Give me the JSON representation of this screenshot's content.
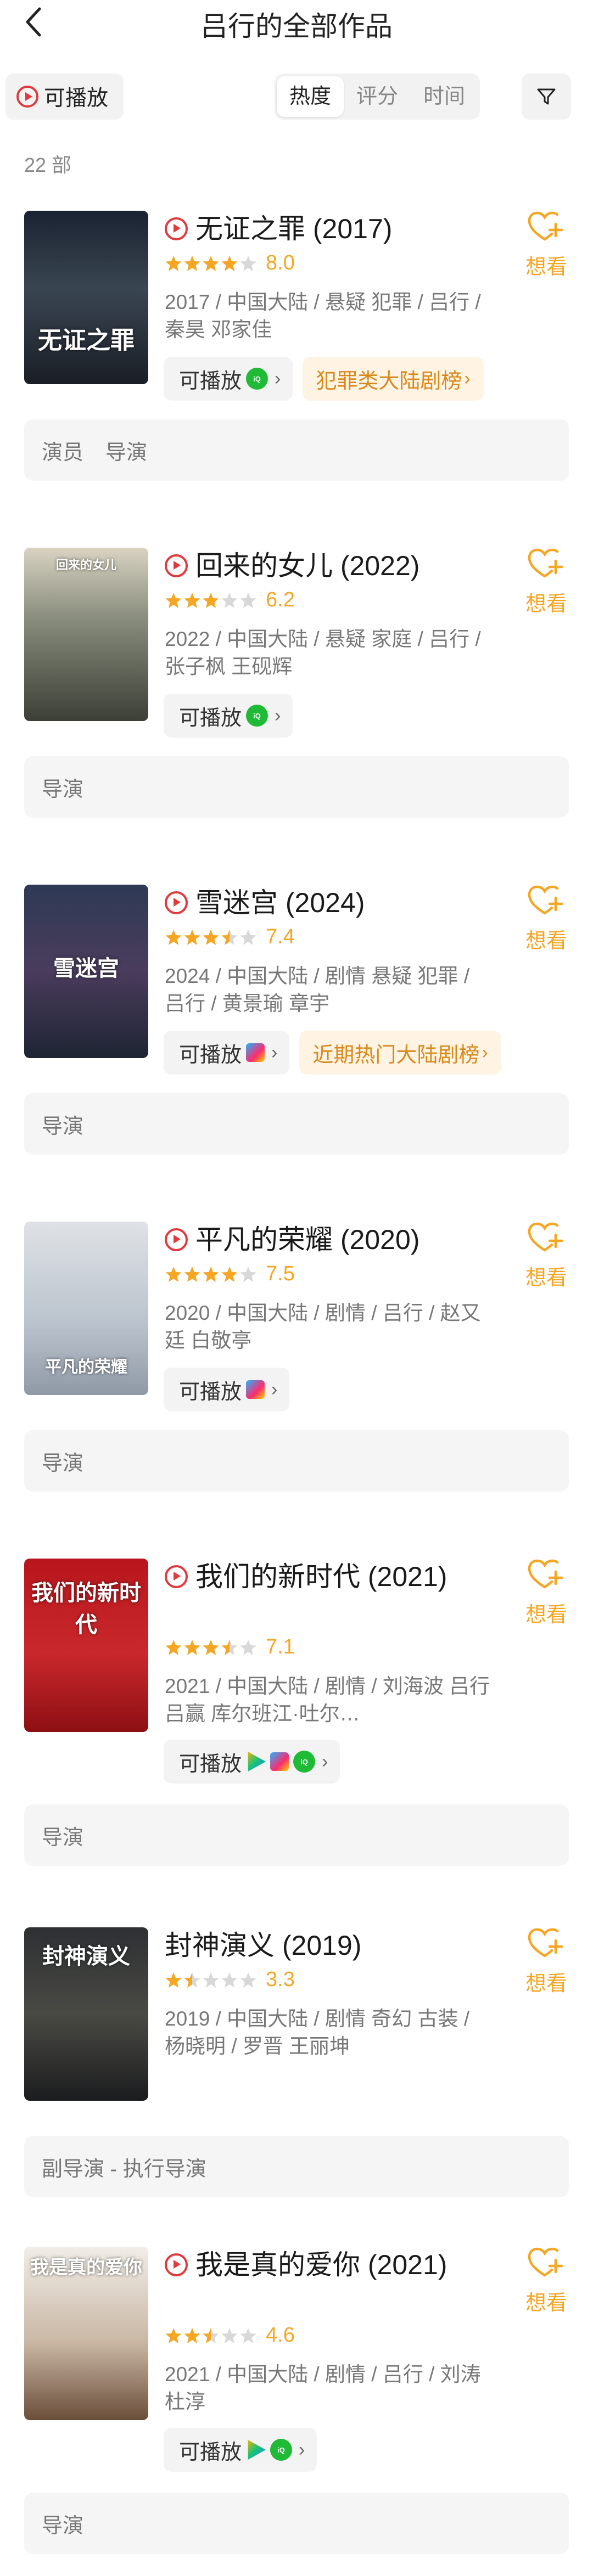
{
  "header": {
    "title": "吕行的全部作品",
    "back_icon": "back-icon"
  },
  "filters": {
    "playable_label": "可播放",
    "sort_tabs": [
      "热度",
      "评分",
      "时间"
    ],
    "active_sort": "热度",
    "filter_icon": "funnel-icon"
  },
  "count_label": "22 部",
  "colors": {
    "accent": "#f5a623",
    "play_red": "#e0393e",
    "rank_text": "#d8891d",
    "rank_bg": "#fff4e3"
  },
  "items": [
    {
      "name": "无证之罪 (2017)",
      "has_play_icon": true,
      "stars": 4,
      "rating": "8.0",
      "meta": "2017 / 中国大陆 / 悬疑 犯罪 / 吕行 / 秦昊 邓家佳",
      "play_label": "可播放",
      "platforms": [
        "iqiyi"
      ],
      "rank": "犯罪类大陆剧榜",
      "want_label": "想看",
      "roles": [
        "演员",
        "导演"
      ],
      "poster_text": "无证之罪"
    },
    {
      "name": "回来的女儿 (2022)",
      "has_play_icon": true,
      "stars": 3,
      "rating": "6.2",
      "meta": "2022 / 中国大陆 / 悬疑 家庭 / 吕行 / 张子枫 王砚辉",
      "play_label": "可播放",
      "platforms": [
        "iqiyi"
      ],
      "rank": "",
      "want_label": "想看",
      "roles": [
        "导演"
      ],
      "poster_text": "回来的女儿"
    },
    {
      "name": "雪迷宫 (2024)",
      "has_play_icon": true,
      "stars": 3.5,
      "rating": "7.4",
      "meta": "2024 / 中国大陆 / 剧情 悬疑 犯罪 / 吕行 / 黄景瑜 章宇",
      "play_label": "可播放",
      "platforms": [
        "youku"
      ],
      "rank": "近期热门大陆剧榜",
      "want_label": "想看",
      "roles": [
        "导演"
      ],
      "poster_text": "雪迷宫"
    },
    {
      "name": "平凡的荣耀 (2020)",
      "has_play_icon": true,
      "stars": 4,
      "rating": "7.5",
      "meta": "2020 / 中国大陆 / 剧情 / 吕行 / 赵又廷 白敬亭",
      "play_label": "可播放",
      "platforms": [
        "youku"
      ],
      "rank": "",
      "want_label": "想看",
      "roles": [
        "导演"
      ],
      "poster_text": "平凡的荣耀"
    },
    {
      "name": "我们的新时代 (2021)",
      "has_play_icon": true,
      "stars": 3.5,
      "rating": "7.1",
      "meta": "2021 / 中国大陆 / 剧情 / 刘海波 吕行 吕赢 库尔班江·吐尔…",
      "play_label": "可播放",
      "platforms": [
        "tencent",
        "youku",
        "iqiyi"
      ],
      "rank": "",
      "want_label": "想看",
      "roles": [
        "导演"
      ],
      "poster_text": "我们的新时代"
    },
    {
      "name": "封神演义 (2019)",
      "has_play_icon": false,
      "stars": 1.5,
      "rating": "3.3",
      "meta": "2019 / 中国大陆 / 剧情 奇幻 古装 / 杨晓明 / 罗晋 王丽坤",
      "play_label": "",
      "platforms": [],
      "rank": "",
      "want_label": "想看",
      "roles": [
        "副导演 - 执行导演"
      ],
      "poster_text": "封神演义"
    },
    {
      "name": "我是真的爱你 (2021)",
      "has_play_icon": true,
      "stars": 2.5,
      "rating": "4.6",
      "meta": "2021 / 中国大陆 / 剧情 / 吕行 / 刘涛 杜淳",
      "play_label": "可播放",
      "platforms": [
        "tencent",
        "iqiyi"
      ],
      "rank": "",
      "want_label": "想看",
      "roles": [
        "导演"
      ],
      "poster_text": "我是真的爱你"
    }
  ]
}
